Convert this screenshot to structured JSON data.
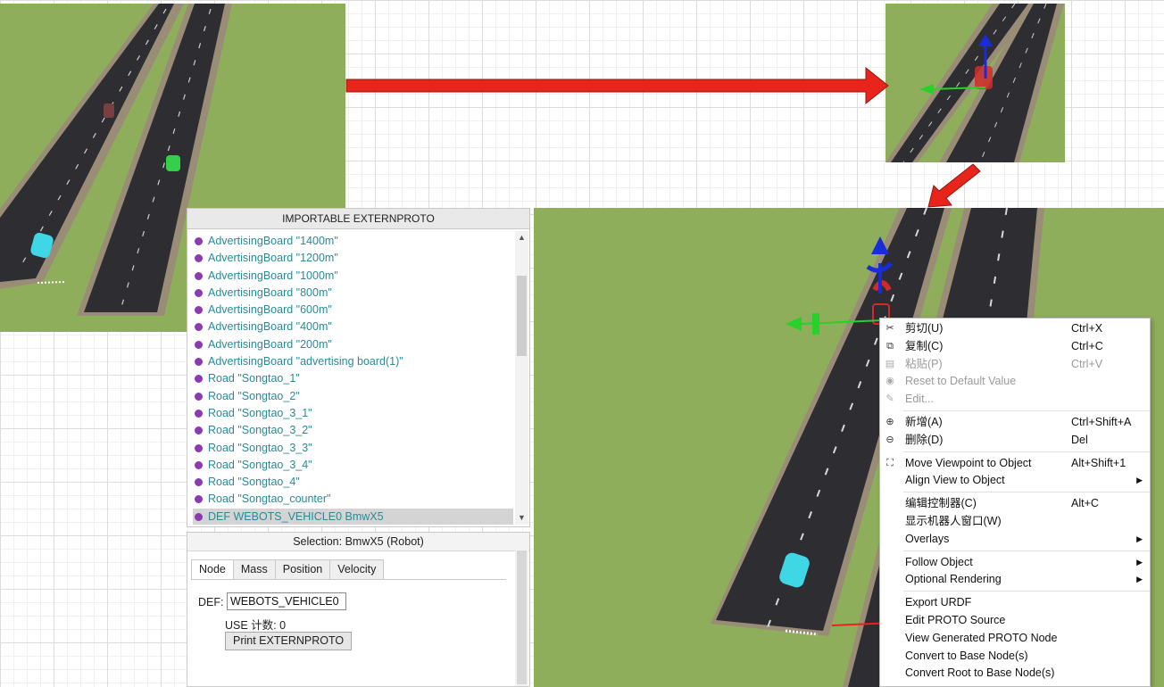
{
  "tree_panel": {
    "title": "IMPORTABLE EXTERNPROTO",
    "items": [
      {
        "label": "AdvertisingBoard \"1400m\""
      },
      {
        "label": "AdvertisingBoard \"1200m\""
      },
      {
        "label": "AdvertisingBoard \"1000m\""
      },
      {
        "label": "AdvertisingBoard \"800m\""
      },
      {
        "label": "AdvertisingBoard \"600m\""
      },
      {
        "label": "AdvertisingBoard \"400m\""
      },
      {
        "label": "AdvertisingBoard \"200m\""
      },
      {
        "label": "AdvertisingBoard \"advertising board(1)\""
      },
      {
        "label": "Road \"Songtao_1\""
      },
      {
        "label": "Road \"Songtao_2\""
      },
      {
        "label": "Road \"Songtao_3_1\""
      },
      {
        "label": "Road \"Songtao_3_2\""
      },
      {
        "label": "Road \"Songtao_3_3\""
      },
      {
        "label": "Road \"Songtao_3_4\""
      },
      {
        "label": "Road \"Songtao_4\""
      },
      {
        "label": "Road \"Songtao_counter\""
      },
      {
        "label": "DEF WEBOTS_VEHICLE0 BmwX5"
      }
    ],
    "selected_index": 16
  },
  "props_panel": {
    "selection": "Selection: BmwX5 (Robot)",
    "tabs": [
      "Node",
      "Mass",
      "Position",
      "Velocity"
    ],
    "active_tab": 0,
    "def_label": "DEF:",
    "def_value": "WEBOTS_VEHICLE0",
    "use_count": "USE 计数:  0",
    "print_button": "Print EXTERNPROTO"
  },
  "context_menu": {
    "groups": [
      [
        {
          "label": "剪切(U)",
          "shortcut": "Ctrl+X",
          "icon": "scissors-icon",
          "disabled": false
        },
        {
          "label": "复制(C)",
          "shortcut": "Ctrl+C",
          "icon": "copy-icon",
          "disabled": false
        },
        {
          "label": "粘贴(P)",
          "shortcut": "Ctrl+V",
          "icon": "paste-icon",
          "disabled": true
        },
        {
          "label": "Reset to Default Value",
          "shortcut": "",
          "icon": "reset-icon",
          "disabled": true
        },
        {
          "label": "Edit...",
          "shortcut": "",
          "icon": "edit-icon",
          "disabled": true
        }
      ],
      [
        {
          "label": "新增(A)",
          "shortcut": "Ctrl+Shift+A",
          "icon": "add-icon",
          "disabled": false
        },
        {
          "label": "删除(D)",
          "shortcut": "Del",
          "icon": "delete-icon",
          "disabled": false
        }
      ],
      [
        {
          "label": "Move Viewpoint to Object",
          "shortcut": "Alt+Shift+1",
          "icon": "viewpoint-icon",
          "disabled": false
        },
        {
          "label": "Align View to Object",
          "shortcut": "",
          "submenu": true,
          "disabled": false
        }
      ],
      [
        {
          "label": "编辑控制器(C)",
          "shortcut": "Alt+C",
          "disabled": false
        },
        {
          "label": "显示机器人窗口(W)",
          "shortcut": "",
          "disabled": false
        },
        {
          "label": "Overlays",
          "shortcut": "",
          "submenu": true,
          "disabled": false
        }
      ],
      [
        {
          "label": "Follow Object",
          "shortcut": "",
          "submenu": true,
          "disabled": false
        },
        {
          "label": "Optional Rendering",
          "shortcut": "",
          "submenu": true,
          "disabled": false
        }
      ],
      [
        {
          "label": "Export URDF",
          "shortcut": "",
          "disabled": false
        },
        {
          "label": "Edit PROTO Source",
          "shortcut": "",
          "disabled": false
        },
        {
          "label": "View Generated PROTO Node",
          "shortcut": "",
          "disabled": false
        },
        {
          "label": "Convert to Base Node(s)",
          "shortcut": "",
          "disabled": false
        },
        {
          "label": "Convert Root to Base Node(s)",
          "shortcut": "",
          "disabled": false
        }
      ]
    ]
  },
  "colors": {
    "grass": "#8fae5b",
    "road": "#2e2e32",
    "accent_arrow": "#e8241b",
    "tree_text": "#2a8a96",
    "node_dot": "#8a3bb0",
    "car_cyan": "#3fd6e6",
    "car_green": "#35d04a"
  }
}
